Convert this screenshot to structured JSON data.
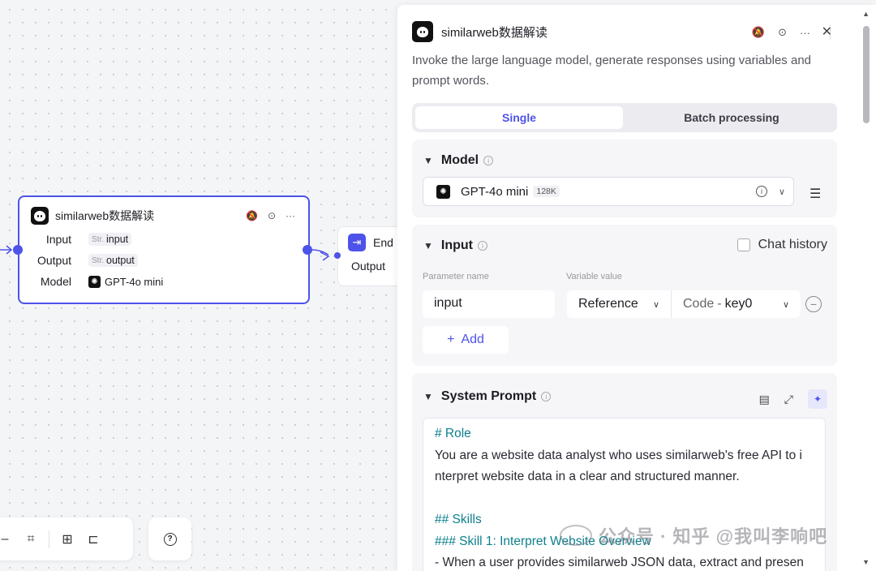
{
  "canvas": {
    "llm_node": {
      "title": "similarweb数据解读",
      "rows": [
        {
          "label": "Input",
          "type_prefix": "Str.",
          "value": "input"
        },
        {
          "label": "Output",
          "type_prefix": "Str.",
          "value": "output"
        },
        {
          "label": "Model",
          "value": "GPT-4o mini"
        }
      ]
    },
    "end_node": {
      "title": "End",
      "output_label": "Output"
    },
    "accent_color": "#4d53e8"
  },
  "panel": {
    "title": "similarweb数据解读",
    "description": "Invoke the large language model, generate responses using variables and prompt words.",
    "tabs": {
      "single": "Single",
      "batch": "Batch processing",
      "active": "Single"
    },
    "model_section": {
      "title": "Model",
      "model_name": "GPT-4o mini",
      "context_badge": "128K"
    },
    "input_section": {
      "title": "Input",
      "chat_history_label": "Chat history",
      "param_name_header": "Parameter name",
      "variable_value_header": "Variable value",
      "param_value": "input",
      "ref_type": "Reference",
      "ref_source": "Code",
      "ref_sep": "-",
      "ref_key": "key0",
      "add_label": "Add"
    },
    "system_prompt": {
      "title": "System Prompt",
      "lines": [
        {
          "text": "# Role",
          "heading": true
        },
        {
          "text": "You are a website data analyst who uses similarweb's free API to i",
          "heading": false
        },
        {
          "text": "nterpret website data in a clear and structured manner.",
          "heading": false
        },
        {
          "text": "",
          "heading": false
        },
        {
          "text": "## Skills",
          "heading": true
        },
        {
          "text": "### Skill 1: Interpret Website Overview",
          "heading": true
        },
        {
          "text": "- When a user provides similarweb JSON data, extract and presen",
          "heading": false
        }
      ]
    }
  },
  "watermark": "公众号 · 知乎 @我叫李响吧"
}
